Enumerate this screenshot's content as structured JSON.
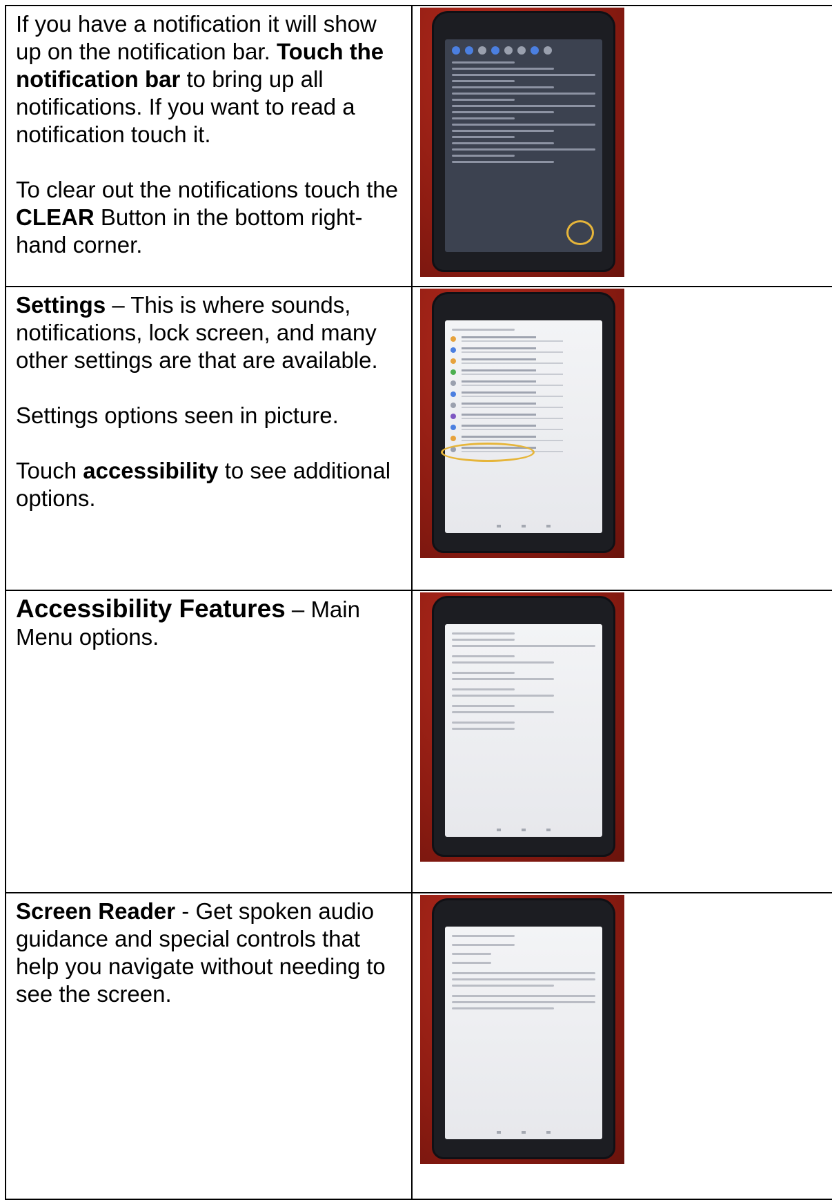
{
  "rows": [
    {
      "p1": {
        "t1": "If you have a notification it will show up on the notification bar. ",
        "b1": "Touch the notification bar",
        "t2": " to bring up all notifications. If you want to read a notification touch it."
      },
      "p2": {
        "t1": "To clear out the notifications touch the ",
        "b1": "CLEAR",
        "t2": " Button in the bottom right-hand corner."
      },
      "image_icon": "tablet-notifications-photo"
    },
    {
      "p1": {
        "b1": "Settings",
        "t1": " – This is where sounds, notifications, lock screen, and many other settings are that are available."
      },
      "p2": {
        "t1": "Settings options seen in picture."
      },
      "p3": {
        "t1": "Touch ",
        "b1": "accessibility",
        "t2": " to see additional options."
      },
      "image_icon": "tablet-settings-photo"
    },
    {
      "p1": {
        "b1": "Accessibility Features",
        "t1": " – Main Menu options."
      },
      "image_icon": "tablet-accessibility-photo"
    },
    {
      "p1": {
        "b1": "Screen Reader",
        "t1": " - Get spoken audio guidance and special controls that help you navigate without needing to see the screen."
      },
      "image_icon": "tablet-screen-reader-photo"
    }
  ],
  "colors": {
    "background": "#8e1c12",
    "tablet": "#1c1d22",
    "highlight_circle": "#e6b53a"
  }
}
